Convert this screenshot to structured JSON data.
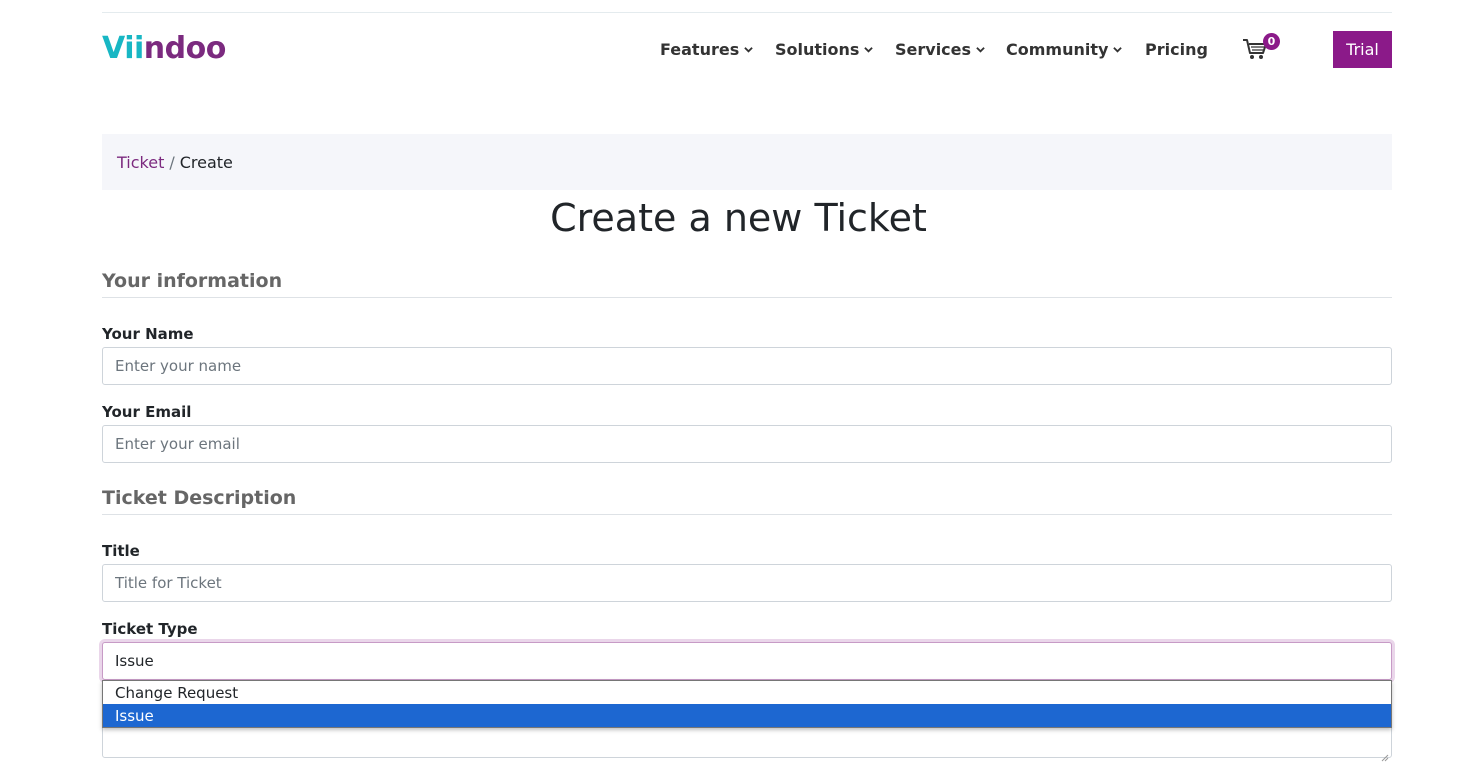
{
  "brand": {
    "logo_part1": "Vii",
    "logo_part2": "ndoo"
  },
  "nav": {
    "items": [
      {
        "label": "Features"
      },
      {
        "label": "Solutions"
      },
      {
        "label": "Services"
      },
      {
        "label": "Community"
      },
      {
        "label": "Pricing"
      }
    ],
    "cart_count": "0",
    "trial_label": "Trial"
  },
  "breadcrumb": {
    "parent": "Ticket",
    "separator": "/",
    "current": "Create"
  },
  "page_title": "Create a new Ticket",
  "sections": {
    "info_heading": "Your information",
    "desc_heading": "Ticket Description"
  },
  "form": {
    "name_label": "Your Name",
    "name_placeholder": "Enter your name",
    "email_label": "Your Email",
    "email_placeholder": "Enter your email",
    "title_label": "Title",
    "title_placeholder": "Title for Ticket",
    "type_label": "Ticket Type",
    "type_value": "Issue",
    "type_options": [
      "Change Request",
      "Issue"
    ]
  },
  "colors": {
    "brand_purple": "#8b1a89",
    "logo_teal": "#18b7c4",
    "selected_option": "#1d67d1"
  }
}
